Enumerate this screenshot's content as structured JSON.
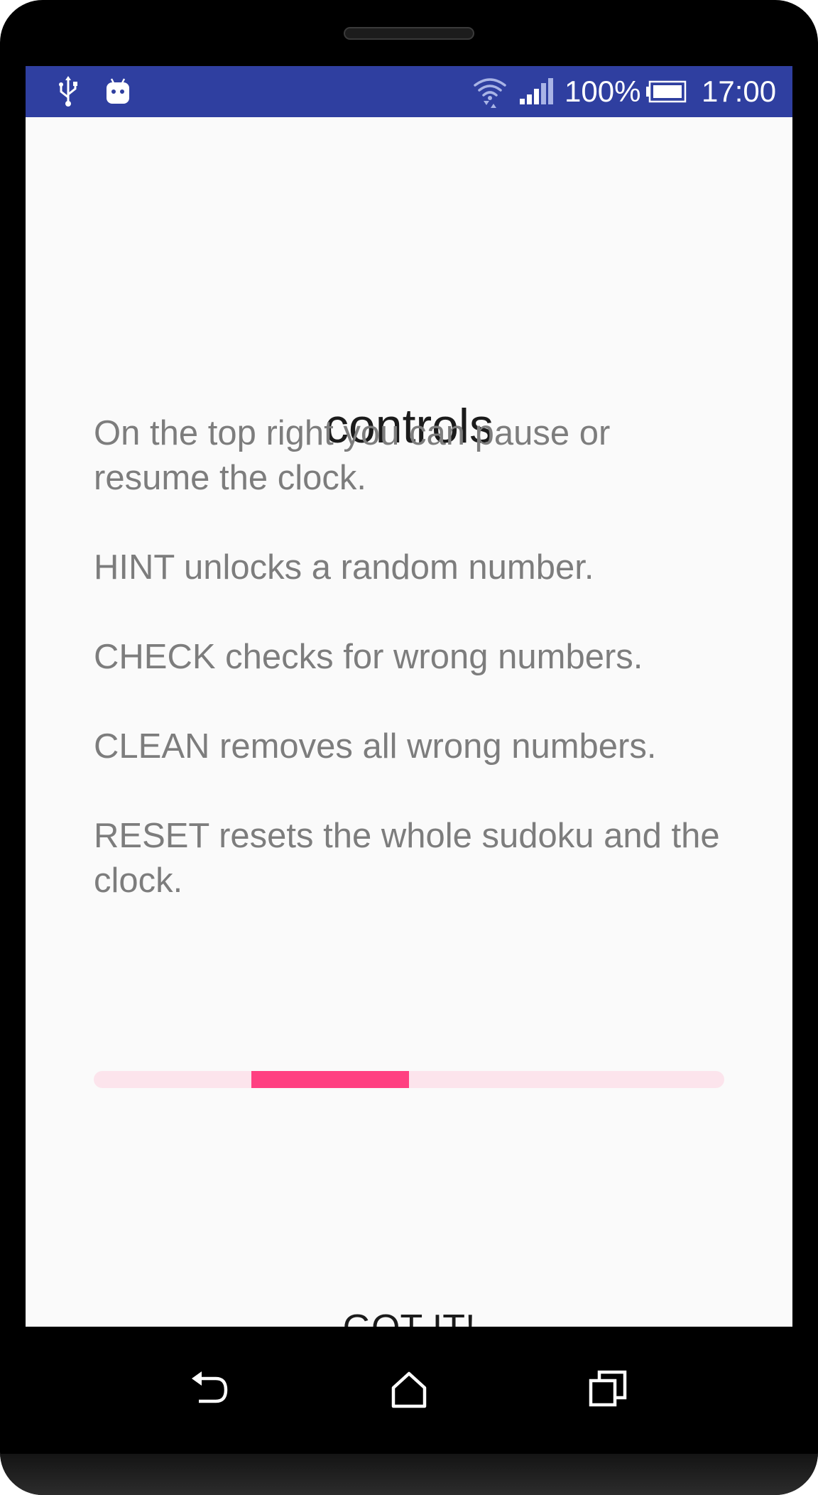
{
  "status_bar": {
    "battery_percent": "100%",
    "time": "17:00",
    "icons": [
      "usb-icon",
      "android-icon",
      "wifi-icon",
      "signal-icon",
      "battery-icon"
    ],
    "background_color": "#2f3fa0"
  },
  "dialog": {
    "title": "controls",
    "paragraphs": [
      "On the top right you can pause or resume the clock.",
      "HINT unlocks a random number.",
      "CHECK checks for wrong numbers.",
      "CLEAN removes all wrong numbers.",
      "RESET resets the whole sudoku and the clock."
    ],
    "progress": {
      "start_fraction": 0.25,
      "end_fraction": 0.5,
      "track_color": "#fce4ec",
      "fill_color": "#ff4081"
    },
    "confirm_button": "GOT IT!"
  },
  "nav_bar": {
    "icons": [
      "back-icon",
      "home-icon",
      "recents-icon"
    ]
  }
}
